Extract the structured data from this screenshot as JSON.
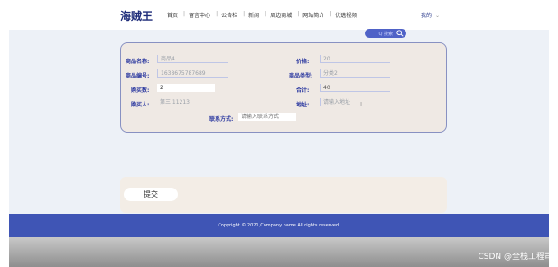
{
  "header": {
    "logo": "海贼王",
    "nav_items": [
      "首页",
      "留言中心",
      "公告栏",
      "新闻",
      "周边商城",
      "网站简介",
      "优选视频"
    ],
    "user_menu": "我的"
  },
  "search": {
    "placeholder": "Q 搜索"
  },
  "form": {
    "fields": {
      "product_name": {
        "label": "商品名称:",
        "value": "商品4"
      },
      "price": {
        "label": "价格:",
        "value": "20"
      },
      "product_code": {
        "label": "商品编号:",
        "value": "1638675787689"
      },
      "product_category": {
        "label": "商品类型:",
        "value": "分类2"
      },
      "quantity": {
        "label": "购买数:",
        "value": "2"
      },
      "total": {
        "label": "合计:",
        "value": "40"
      },
      "buyer": {
        "label": "购买人:",
        "value": "第三 11213"
      },
      "address": {
        "label": "地址:",
        "placeholder": "请输入地址"
      },
      "contact": {
        "label": "联系方式:",
        "placeholder": "请输入联系方式"
      }
    }
  },
  "submit": {
    "label": "提交"
  },
  "footer": {
    "text": "Copyright © 2021,Company name All rights reserved."
  },
  "watermark": "CSDN @全栈工程司",
  "colors": {
    "accent": "#3f55b5",
    "label": "#2d3aa0",
    "form_bg": "#efe9e4"
  }
}
